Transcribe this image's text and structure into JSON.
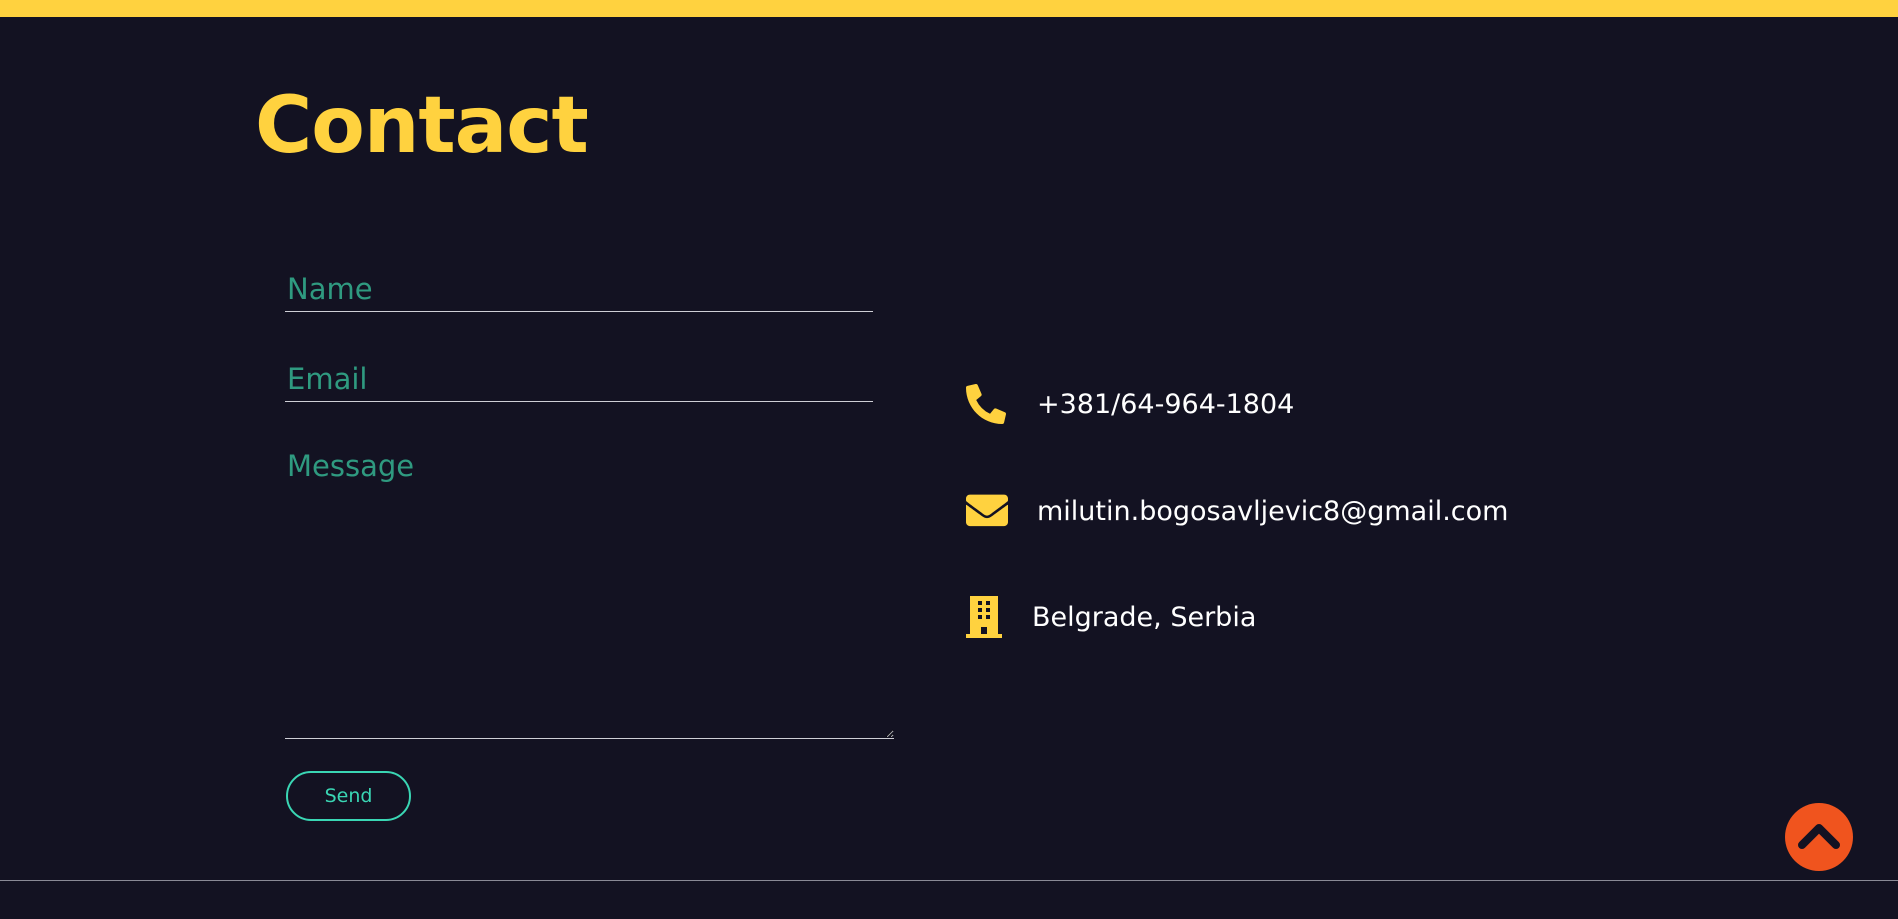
{
  "colors": {
    "background": "#131222",
    "accent": "#ffd23f",
    "placeholder": "#2f9a80",
    "button": "#3ad6b4",
    "scroll_top": "#f0541e"
  },
  "header": {
    "title": "Contact"
  },
  "form": {
    "name_placeholder": "Name",
    "email_placeholder": "Email",
    "message_placeholder": "Message",
    "send_label": "Send"
  },
  "contact_info": {
    "phone": {
      "icon": "phone-icon",
      "text": "+381/64-964-1804"
    },
    "email": {
      "icon": "envelope-icon",
      "text": "milutin.bogosavljevic8@gmail.com"
    },
    "address": {
      "icon": "building-icon",
      "text": "Belgrade, Serbia"
    }
  },
  "scroll_top": {
    "icon": "chevron-up-icon"
  }
}
